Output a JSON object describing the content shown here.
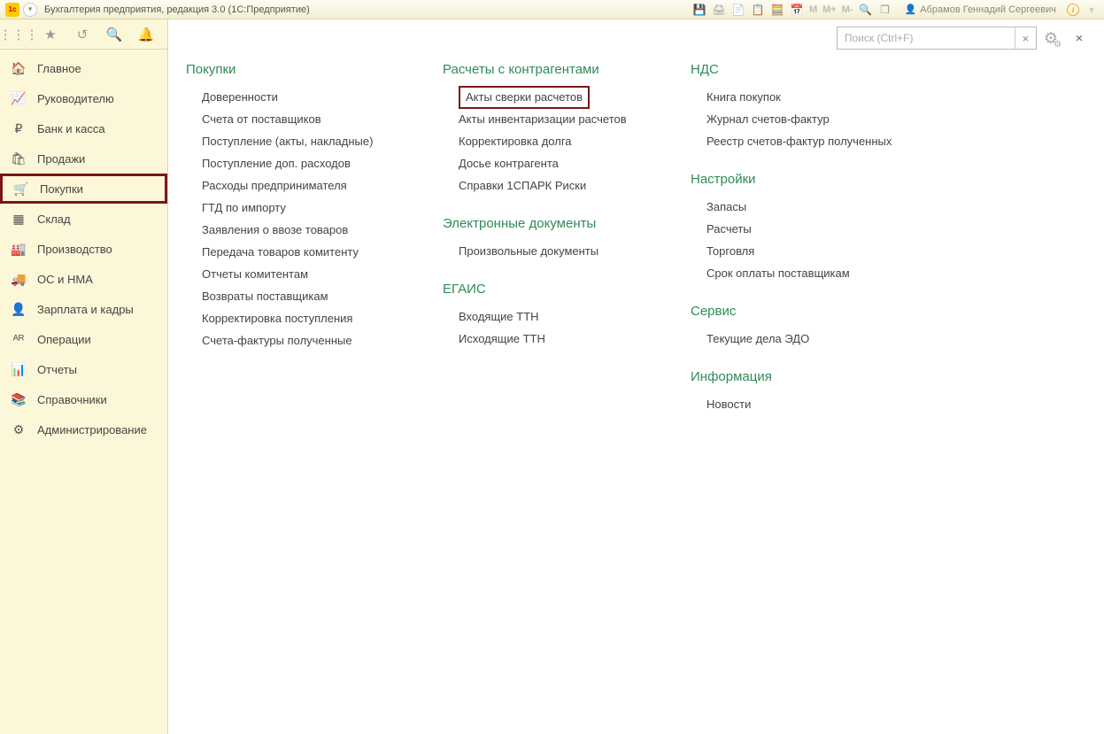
{
  "title": "Бухгалтерия предприятия, редакция 3.0  (1С:Предприятие)",
  "toolbar_icons": {
    "m": "M",
    "mplus": "M+",
    "mminus": "M-"
  },
  "user_name": "Абрамов Геннадий Сергеевич",
  "search_placeholder": "Поиск (Ctrl+F)",
  "sidebar": [
    {
      "icon": "home",
      "label": "Главное"
    },
    {
      "icon": "chart",
      "label": "Руководителю"
    },
    {
      "icon": "ruble",
      "label": "Банк и касса"
    },
    {
      "icon": "bag",
      "label": "Продажи"
    },
    {
      "icon": "cart",
      "label": "Покупки",
      "active": true
    },
    {
      "icon": "warehouse",
      "label": "Склад"
    },
    {
      "icon": "factory",
      "label": "Производство"
    },
    {
      "icon": "truck",
      "label": "ОС и НМА"
    },
    {
      "icon": "person",
      "label": "Зарплата и кадры"
    },
    {
      "icon": "ops",
      "label": "Операции"
    },
    {
      "icon": "bars",
      "label": "Отчеты"
    },
    {
      "icon": "books",
      "label": "Справочники"
    },
    {
      "icon": "gear",
      "label": "Администрирование"
    }
  ],
  "columns": {
    "col1": {
      "title": "Покупки",
      "items": [
        "Доверенности",
        "Счета от поставщиков",
        "Поступление (акты, накладные)",
        "Поступление доп. расходов",
        "Расходы предпринимателя",
        "ГТД по импорту",
        "Заявления о ввозе товаров",
        "Передача товаров комитенту",
        "Отчеты комитентам",
        "Возвраты поставщикам",
        "Корректировка поступления",
        "Счета-фактуры полученные"
      ]
    },
    "col2": [
      {
        "title": "Расчеты с контрагентами",
        "items": [
          {
            "label": "Акты сверки расчетов",
            "hl": true
          },
          {
            "label": "Акты инвентаризации расчетов"
          },
          {
            "label": "Корректировка долга"
          },
          {
            "label": "Досье контрагента"
          },
          {
            "label": "Справки 1СПАРК Риски"
          }
        ]
      },
      {
        "title": "Электронные документы",
        "items": [
          {
            "label": "Произвольные документы"
          }
        ]
      },
      {
        "title": "ЕГАИС",
        "items": [
          {
            "label": "Входящие ТТН"
          },
          {
            "label": "Исходящие ТТН"
          }
        ]
      }
    ],
    "col3": [
      {
        "title": "НДС",
        "items": [
          "Книга покупок",
          "Журнал счетов-фактур",
          "Реестр счетов-фактур полученных"
        ]
      },
      {
        "title": "Настройки",
        "items": [
          "Запасы",
          "Расчеты",
          "Торговля",
          "Срок оплаты поставщикам"
        ]
      },
      {
        "title": "Сервис",
        "items": [
          "Текущие дела ЭДО"
        ]
      },
      {
        "title": "Информация",
        "items": [
          "Новости"
        ]
      }
    ]
  }
}
